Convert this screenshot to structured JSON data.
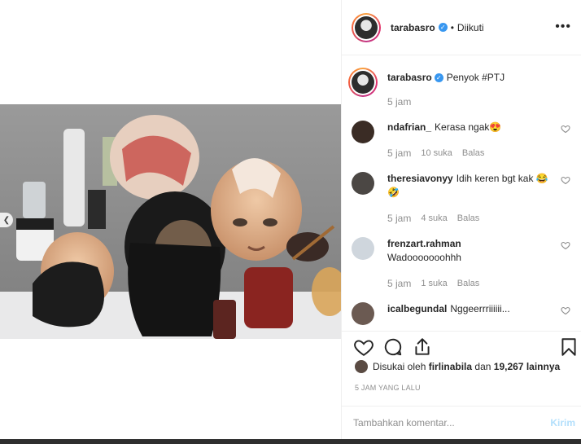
{
  "post": {
    "author": "tarabasro",
    "follow_status": "Diikuti",
    "more_icon": "more-horizontal-icon",
    "caption": "Penyok #PTJ",
    "caption_time": "5 jam"
  },
  "comments": [
    {
      "user": "ndafrian_",
      "text": "Kerasa ngak😍",
      "time": "5 jam",
      "likes": "10 suka",
      "reply": "Balas"
    },
    {
      "user": "theresiavonyy",
      "text": "Idih keren bgt kak 😂🤣",
      "time": "5 jam",
      "likes": "4 suka",
      "reply": "Balas"
    },
    {
      "user": "frenzart.rahman",
      "text": "Wadooooooohhh",
      "time": "5 jam",
      "likes": "1 suka",
      "reply": "Balas"
    },
    {
      "user": "icalbegundal",
      "text": "Nggeerrriiiiii...",
      "time": "",
      "likes": "",
      "reply": ""
    }
  ],
  "likes": {
    "prefix": "Disukai oleh",
    "first_user": "firlinabila",
    "conjunction": "dan",
    "count": "19,267 lainnya"
  },
  "time_ago": "5 JAM YANG LALU",
  "add_comment": {
    "placeholder": "Tambahkan komentar...",
    "send_label": "Kirim"
  },
  "colors": {
    "verified": "#3897f0",
    "send_disabled": "#b2dffc",
    "muted": "#8e8e8e"
  },
  "icons": [
    "heart-icon",
    "comment-icon",
    "share-icon",
    "bookmark-icon",
    "verified-icon",
    "carousel-prev-icon"
  ]
}
